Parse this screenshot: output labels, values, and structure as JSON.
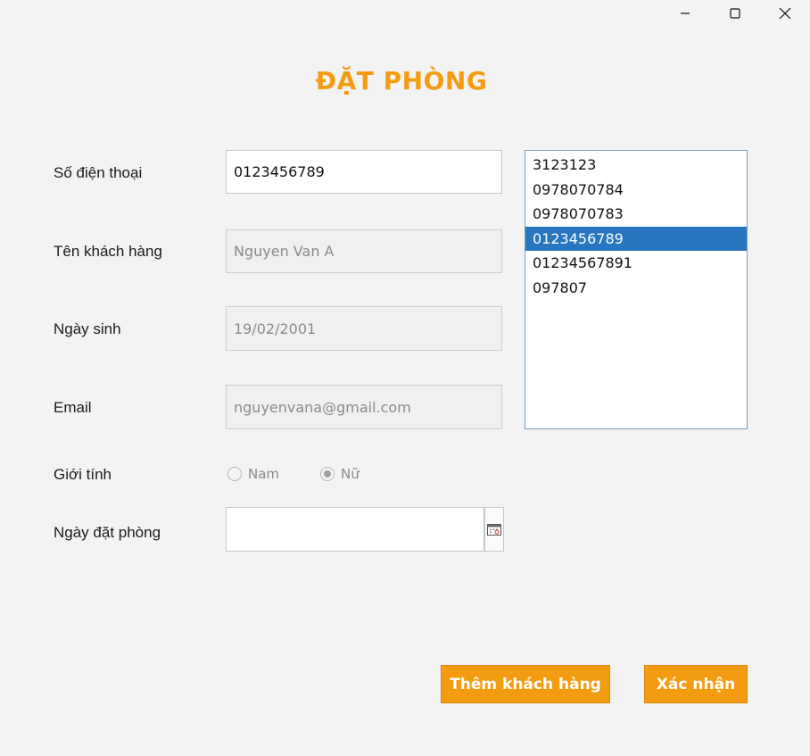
{
  "window": {
    "title": "ĐẶT PHÒNG"
  },
  "form": {
    "phone_label": "Số điện thoại",
    "phone_value": "0123456789",
    "name_label": "Tên khách hàng",
    "name_value": "Nguyen Van A",
    "dob_label": "Ngày sinh",
    "dob_value": "19/02/2001",
    "email_label": "Email",
    "email_value": "nguyenvana@gmail.com",
    "gender_label": "Giới tính",
    "gender_options": [
      {
        "label": "Nam",
        "selected": false
      },
      {
        "label": "Nữ",
        "selected": true
      }
    ],
    "booking_date_label": "Ngày đặt phòng",
    "booking_date_value": ""
  },
  "phone_list": {
    "items": [
      "3123123",
      "0978070784",
      "0978070783",
      "0123456789",
      "01234567891",
      "097807"
    ],
    "selected_index": 3
  },
  "actions": {
    "add_customer_label": "Thêm khách hàng",
    "confirm_label": "Xác nhận"
  },
  "colors": {
    "accent": "#f39c12",
    "selection": "#2875c0"
  }
}
